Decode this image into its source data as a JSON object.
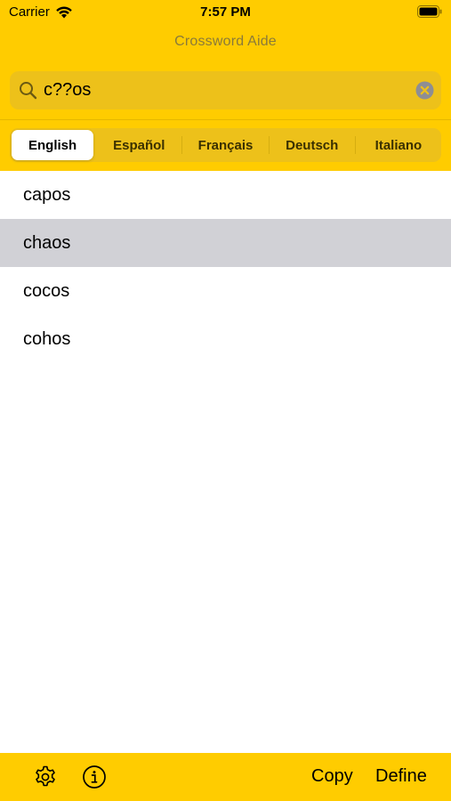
{
  "status_bar": {
    "carrier": "Carrier",
    "time": "7:57 PM"
  },
  "header": {
    "title": "Crossword Aide"
  },
  "search": {
    "value": "c??os"
  },
  "languages": {
    "selected": "English",
    "items": [
      "English",
      "Español",
      "Français",
      "Deutsch",
      "Italiano"
    ]
  },
  "results": {
    "highlighted": "chaos",
    "items": [
      "capos",
      "chaos",
      "cocos",
      "cohos"
    ]
  },
  "toolbar": {
    "settings_icon": "gear-icon",
    "info_icon": "info-icon",
    "copy_label": "Copy",
    "define_label": "Define"
  },
  "colors": {
    "accent": "#FFCC00",
    "field_background": "#EDC11A",
    "highlight_row": "#D1D1D6",
    "title_text": "#8A7A3A"
  }
}
